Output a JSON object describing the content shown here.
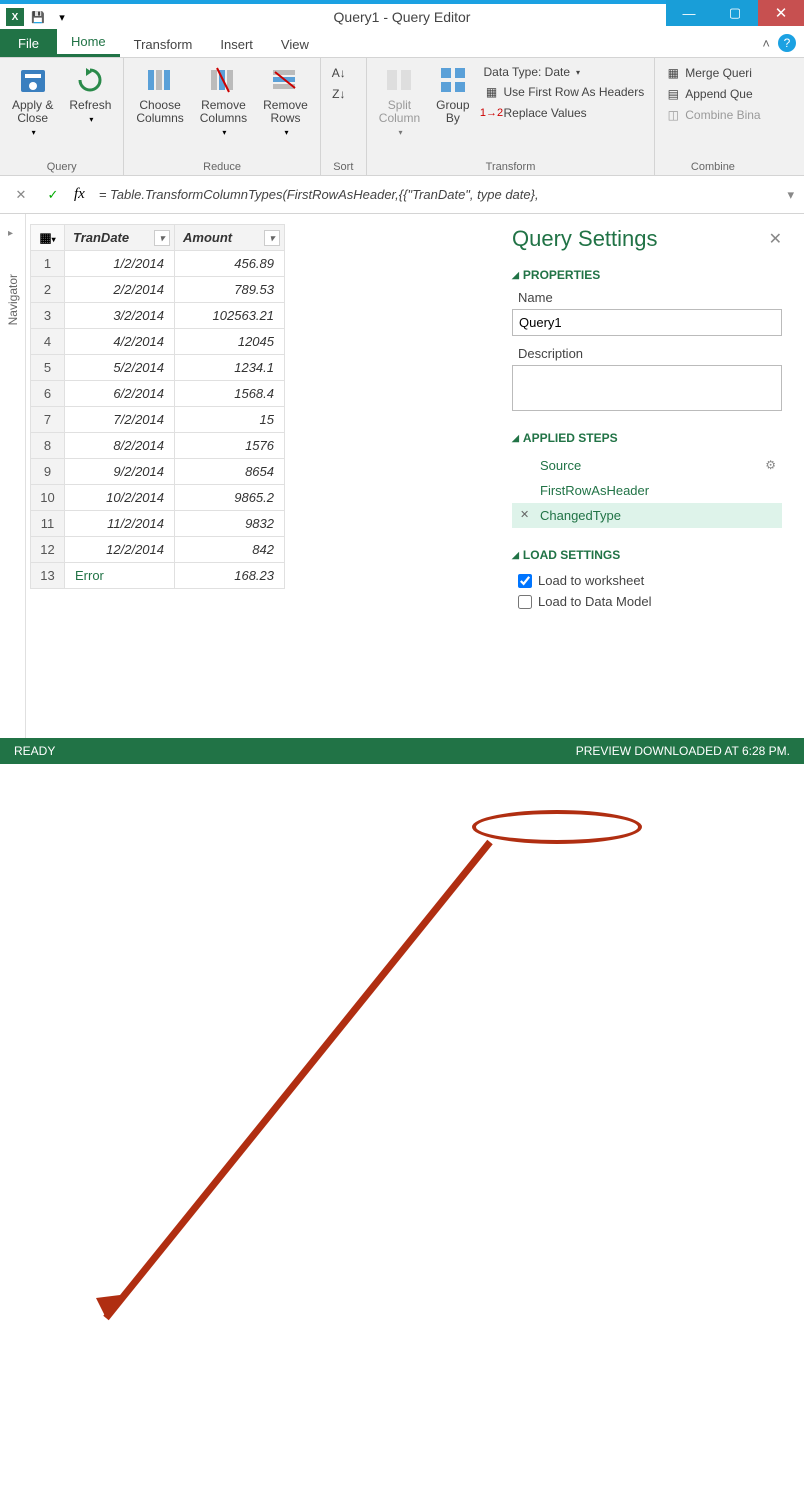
{
  "window": {
    "title": "Query1 - Query Editor"
  },
  "tabs": {
    "file": "File",
    "home": "Home",
    "transform": "Transform",
    "insert": "Insert",
    "view": "View"
  },
  "ribbon": {
    "query": {
      "apply_close": "Apply &\nClose",
      "refresh": "Refresh",
      "group": "Query"
    },
    "reduce": {
      "choose_cols": "Choose\nColumns",
      "remove_cols": "Remove\nColumns",
      "remove_rows": "Remove\nRows",
      "group": "Reduce"
    },
    "sort": {
      "group": "Sort"
    },
    "transform": {
      "split_col": "Split\nColumn",
      "group_by": "Group\nBy",
      "data_type": "Data Type: Date",
      "first_row": "Use First Row As Headers",
      "replace": "Replace Values",
      "group": "Transform"
    },
    "combine": {
      "merge": "Merge Queri",
      "append": "Append Que",
      "combine_bin": "Combine Bina",
      "group": "Combine"
    }
  },
  "formula_bar": {
    "formula": "= Table.TransformColumnTypes(FirstRowAsHeader,{{\"TranDate\", type date},"
  },
  "navigator": {
    "label": "Navigator"
  },
  "grid": {
    "headers": [
      "TranDate",
      "Amount"
    ],
    "rows": [
      {
        "n": "1",
        "c": [
          "1/2/2014",
          "456.89"
        ]
      },
      {
        "n": "2",
        "c": [
          "2/2/2014",
          "789.53"
        ]
      },
      {
        "n": "3",
        "c": [
          "3/2/2014",
          "102563.21"
        ]
      },
      {
        "n": "4",
        "c": [
          "4/2/2014",
          "12045"
        ]
      },
      {
        "n": "5",
        "c": [
          "5/2/2014",
          "1234.1"
        ]
      },
      {
        "n": "6",
        "c": [
          "6/2/2014",
          "1568.4"
        ]
      },
      {
        "n": "7",
        "c": [
          "7/2/2014",
          "15"
        ]
      },
      {
        "n": "8",
        "c": [
          "8/2/2014",
          "1576"
        ]
      },
      {
        "n": "9",
        "c": [
          "9/2/2014",
          "8654"
        ]
      },
      {
        "n": "10",
        "c": [
          "10/2/2014",
          "9865.2"
        ]
      },
      {
        "n": "11",
        "c": [
          "11/2/2014",
          "9832"
        ]
      },
      {
        "n": "12",
        "c": [
          "12/2/2014",
          "842"
        ]
      },
      {
        "n": "13",
        "c": [
          "Error",
          "168.23"
        ],
        "error": true
      }
    ]
  },
  "settings": {
    "title": "Query Settings",
    "properties": "PROPERTIES",
    "name_label": "Name",
    "name_value": "Query1",
    "desc_label": "Description",
    "applied_steps": "APPLIED STEPS",
    "steps": [
      {
        "label": "Source",
        "gear": true
      },
      {
        "label": "FirstRowAsHeader"
      },
      {
        "label": "ChangedType",
        "selected": true,
        "deletable": true
      }
    ],
    "load_settings": "LOAD SETTINGS",
    "load_ws": "Load to worksheet",
    "load_ws_checked": true,
    "load_dm": "Load to Data Model",
    "load_dm_checked": false
  },
  "statusbar": {
    "ready": "READY",
    "preview": "PREVIEW DOWNLOADED AT 6:28 PM."
  }
}
